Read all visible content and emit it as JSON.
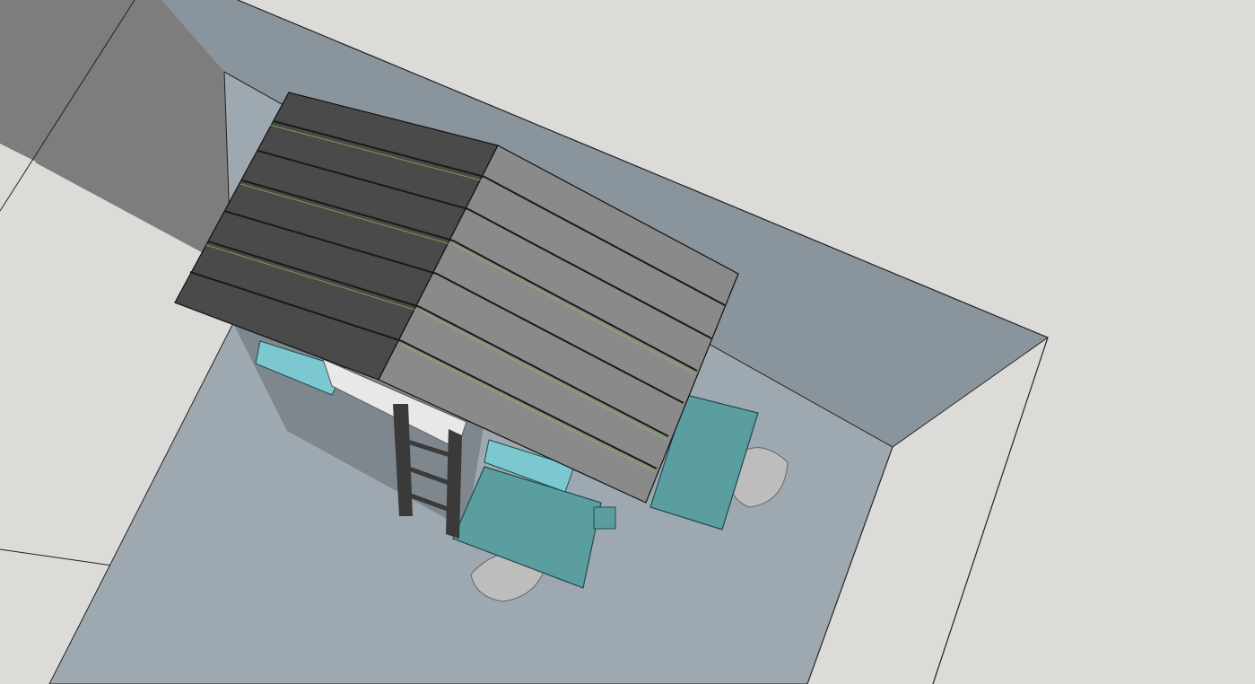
{
  "scene": {
    "kind": "3d-model-viewport",
    "colors": {
      "background": "#dcdbd8",
      "floor": "#9ea8b1",
      "wall_shadow": "#8a949d",
      "roof_dark": "#4a4a4a",
      "roof_light": "#8a8a8a",
      "accent_teal": "#5a9ea0",
      "accent_cyan": "#7cc8d0",
      "ladder": "#3a3a3a",
      "chair": "#bdbdbd"
    },
    "objects": [
      "floor-plane",
      "wall-shadow",
      "building-shadow",
      "roof-left-slope",
      "roof-right-slope",
      "ladder",
      "teal-bench-front",
      "teal-bench-right",
      "window-box-left",
      "window-box-center",
      "chair-front",
      "chair-right"
    ]
  }
}
